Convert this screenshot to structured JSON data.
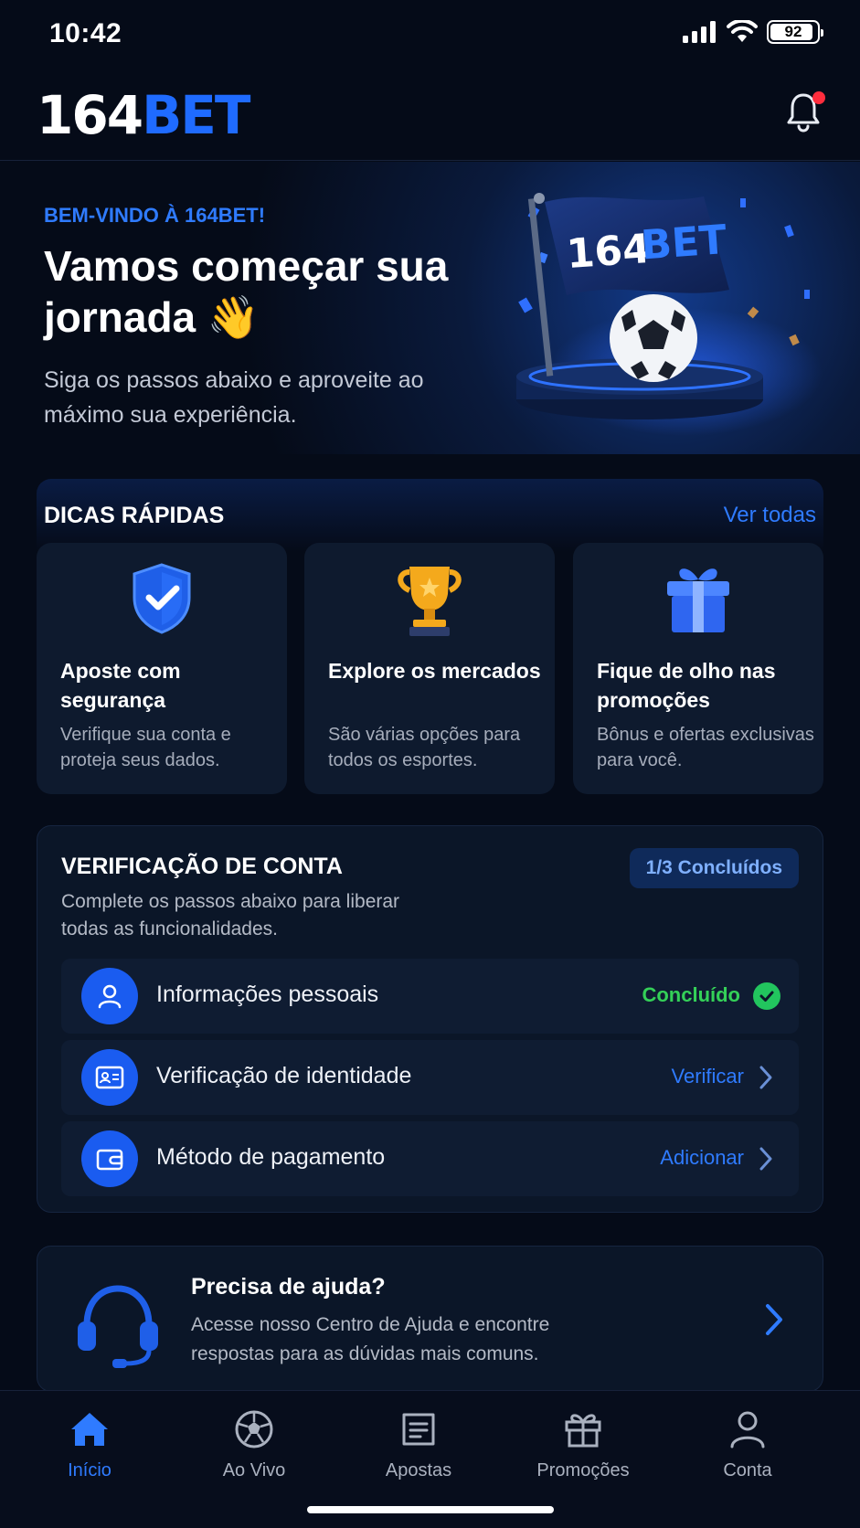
{
  "status_bar": {
    "time": "10:42",
    "battery": "92"
  },
  "header": {
    "logo_part1": "164",
    "logo_part2": "BET"
  },
  "hero": {
    "kicker": "BEM-VINDO À 164BET!",
    "title": "Vamos começar sua jornada 👋",
    "subtitle": "Siga os passos abaixo e aproveite ao máximo sua experiência.",
    "flag_text_part1": "164",
    "flag_text_part2": "BET"
  },
  "tips": {
    "title": "DICAS RÁPIDAS",
    "see_all": "Ver todas",
    "cards": [
      {
        "title": "Aposte com segurança",
        "desc": "Verifique sua conta e proteja seus dados.",
        "icon": "shield-check-icon"
      },
      {
        "title": "Explore os mercados",
        "desc": "São várias opções para todos os esportes.",
        "icon": "trophy-icon"
      },
      {
        "title": "Fique de olho nas promoções",
        "desc": "Bônus e ofertas exclusivas para você.",
        "icon": "gift-icon"
      }
    ]
  },
  "verification": {
    "title": "VERIFICAÇÃO DE CONTA",
    "subtitle": "Complete os passos abaixo para liberar todas as funcionalidades.",
    "badge": "1/3 Concluídos",
    "steps": [
      {
        "label": "Informações pessoais",
        "action": "Concluído",
        "icon": "user-icon",
        "status": "done"
      },
      {
        "label": "Verificação de identidade",
        "action": "Verificar",
        "icon": "id-card-icon",
        "status": "pending"
      },
      {
        "label": "Método de pagamento",
        "action": "Adicionar",
        "icon": "wallet-icon",
        "status": "pending"
      }
    ]
  },
  "help": {
    "title": "Precisa de ajuda?",
    "desc": "Acesse nosso Centro de Ajuda e encontre respostas para as dúvidas mais comuns."
  },
  "tabbar": {
    "items": [
      {
        "label": "Início",
        "icon": "home-icon",
        "active": true
      },
      {
        "label": "Ao Vivo",
        "icon": "soccer-ball-icon",
        "active": false
      },
      {
        "label": "Apostas",
        "icon": "ticket-icon",
        "active": false
      },
      {
        "label": "Promoções",
        "icon": "gift-icon",
        "active": false
      },
      {
        "label": "Conta",
        "icon": "user-icon",
        "active": false
      }
    ]
  },
  "colors": {
    "accent": "#1f6bff",
    "link": "#2f7bff",
    "success": "#22c55e",
    "background": "#050b18",
    "notification": "#ff2d3d"
  }
}
